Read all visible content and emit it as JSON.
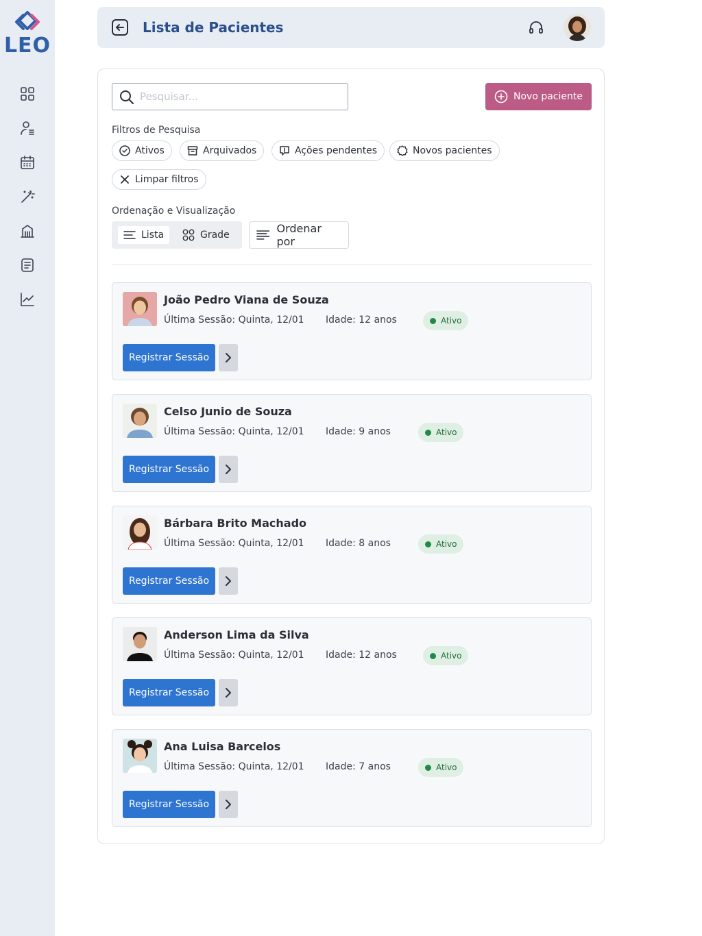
{
  "app": {
    "logo_text": "LEO"
  },
  "sidebar": {
    "items": [
      {
        "name": "dashboard-icon"
      },
      {
        "name": "patients-icon"
      },
      {
        "name": "calendar-icon"
      },
      {
        "name": "magic-wand-icon"
      },
      {
        "name": "institution-icon"
      },
      {
        "name": "notes-icon"
      },
      {
        "name": "chart-line-icon"
      }
    ]
  },
  "header": {
    "title": "Lista de Pacientes"
  },
  "search": {
    "placeholder": "Pesquisar...",
    "value": ""
  },
  "actions": {
    "new_patient": "Novo paciente"
  },
  "filters": {
    "label": "Filtros de Pesquisa",
    "chips": [
      "Ativos",
      "Arquivados",
      "Ações pendentes",
      "Novos pacientes"
    ],
    "clear": "Limpar filtros"
  },
  "view": {
    "label": "Ordenação e Visualização",
    "list": "Lista",
    "grid": "Grade",
    "selected": "Lista",
    "order_by": "Ordenar por"
  },
  "patients": [
    {
      "name": "João Pedro Viana de Souza",
      "session": "Última Sessão: Quinta, 12/01",
      "age": "Idade: 12 anos",
      "status": "Ativo",
      "button": "Registrar Sessão"
    },
    {
      "name": "Celso Junio de Souza",
      "session": "Última Sessão: Quinta, 12/01",
      "age": "Idade: 9 anos",
      "status": "Ativo",
      "button": "Registrar Sessão"
    },
    {
      "name": "Bárbara Brito Machado",
      "session": "Última Sessão: Quinta, 12/01",
      "age": "Idade: 8 anos",
      "status": "Ativo",
      "button": "Registrar Sessão"
    },
    {
      "name": "Anderson Lima da Silva",
      "session": "Última Sessão: Quinta, 12/01",
      "age": "Idade: 12 anos",
      "status": "Ativo",
      "button": "Registrar Sessão"
    },
    {
      "name": "Ana Luisa Barcelos",
      "session": "Última Sessão: Quinta, 12/01",
      "age": "Idade: 7 anos",
      "status": "Ativo",
      "button": "Registrar Sessão"
    }
  ],
  "colors": {
    "primary_button": "#2e74d1",
    "new_patient_button": "#bb5b86",
    "title": "#2a4f8c",
    "status_bg": "#e0efe4",
    "status_dot": "#1f8a45"
  }
}
